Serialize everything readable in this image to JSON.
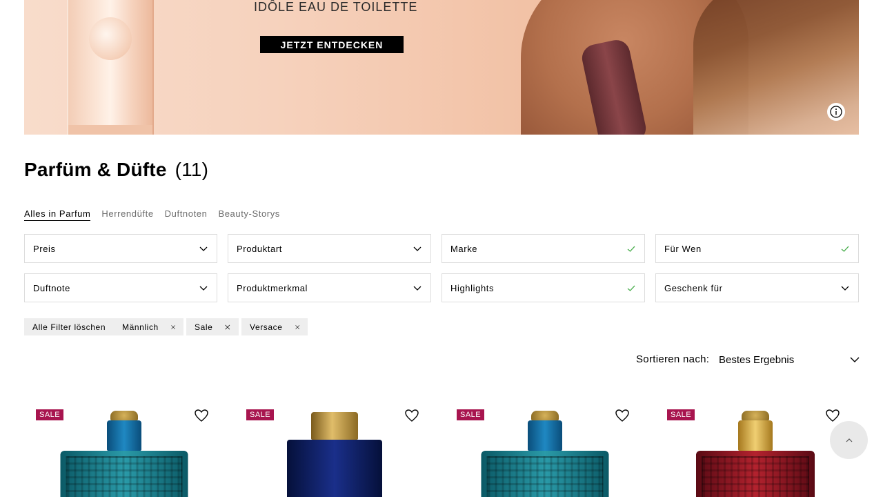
{
  "banner": {
    "headline": "IDÔLE EAU DE TOILETTE",
    "cta_label": "JETZT ENTDECKEN"
  },
  "page": {
    "title": "Parfüm & Düfte",
    "count": "(11)"
  },
  "tabs": [
    {
      "label": "Alles in Parfum",
      "active": true
    },
    {
      "label": "Herrendüfte",
      "active": false
    },
    {
      "label": "Duftnoten",
      "active": false
    },
    {
      "label": "Beauty-Storys",
      "active": false
    }
  ],
  "filters": {
    "row1": [
      {
        "label": "Preis",
        "state": "chevron"
      },
      {
        "label": "Produktart",
        "state": "chevron"
      },
      {
        "label": "Marke",
        "state": "check"
      },
      {
        "label": "Für Wen",
        "state": "check"
      }
    ],
    "row2": [
      {
        "label": "Duftnote",
        "state": "chevron"
      },
      {
        "label": "Produktmerkmal",
        "state": "chevron"
      },
      {
        "label": "Highlights",
        "state": "check"
      },
      {
        "label": "Geschenk für",
        "state": "chevron"
      }
    ]
  },
  "active_filters": {
    "clear_all": "Alle Filter löschen",
    "chips": [
      "Männlich",
      "Sale",
      "Versace"
    ]
  },
  "sort": {
    "label": "Sortieren nach:",
    "value": "Bestes Ergebnis"
  },
  "products": [
    {
      "badge": "SALE",
      "bottle": "eros-blue"
    },
    {
      "badge": "SALE",
      "bottle": "dylan-blue"
    },
    {
      "badge": "SALE",
      "bottle": "eros-blue"
    },
    {
      "badge": "SALE",
      "bottle": "eros-flame"
    }
  ],
  "colors": {
    "sale_badge": "#a8154f",
    "check": "#4caf50",
    "chip_bg": "#eeeeee"
  }
}
